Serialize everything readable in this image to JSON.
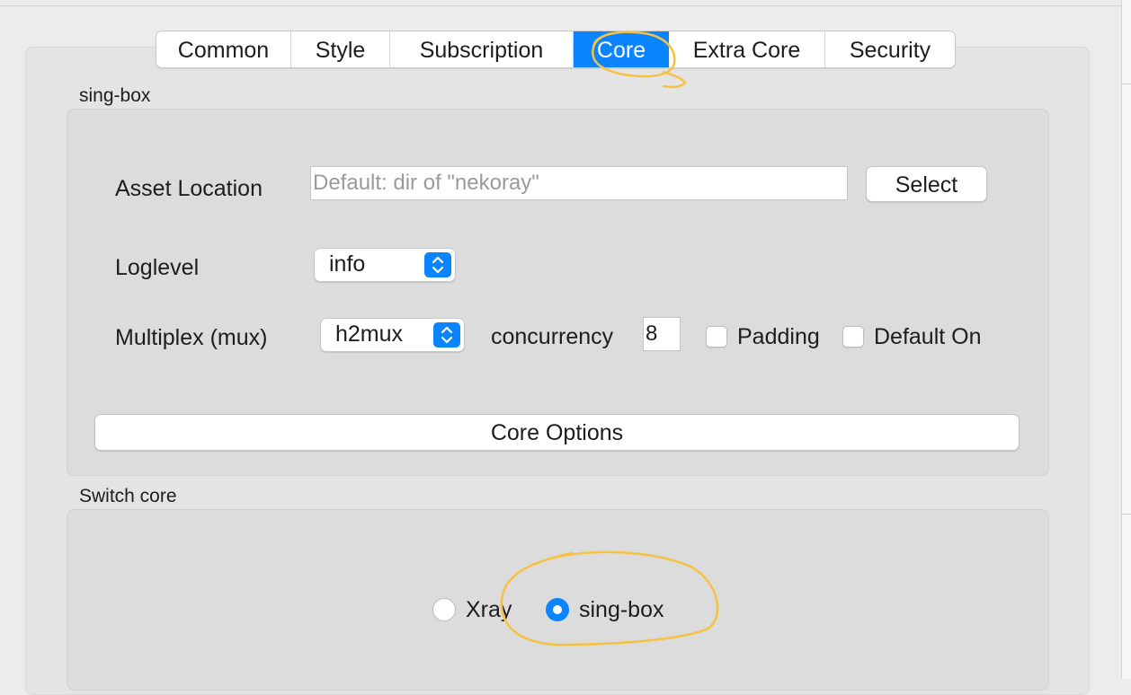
{
  "tabs": [
    {
      "label": "Common",
      "active": false
    },
    {
      "label": "Style",
      "active": false
    },
    {
      "label": "Subscription",
      "active": false
    },
    {
      "label": "Core",
      "active": true
    },
    {
      "label": "Extra Core",
      "active": false
    },
    {
      "label": "Security",
      "active": false
    }
  ],
  "singbox_group": {
    "title": "sing-box",
    "asset_location": {
      "label": "Asset Location",
      "value": "",
      "placeholder": "Default: dir of \"nekoray\"",
      "select_label": "Select"
    },
    "loglevel": {
      "label": "Loglevel",
      "selected": "info"
    },
    "mux": {
      "label": "Multiplex (mux)",
      "selected": "h2mux",
      "concurrency_label": "concurrency",
      "concurrency_value": "8",
      "padding_label": "Padding",
      "padding_checked": false,
      "default_on_label": "Default On",
      "default_on_checked": false
    },
    "core_options_label": "Core Options"
  },
  "switch_core_group": {
    "title": "Switch core",
    "options": [
      {
        "label": "Xray",
        "selected": false
      },
      {
        "label": "sing-box",
        "selected": true
      }
    ]
  },
  "colors": {
    "accent": "#0a84ff",
    "annotation": "#f5c242"
  },
  "icons": {
    "combo_arrows": "chevron-up-down-icon"
  }
}
